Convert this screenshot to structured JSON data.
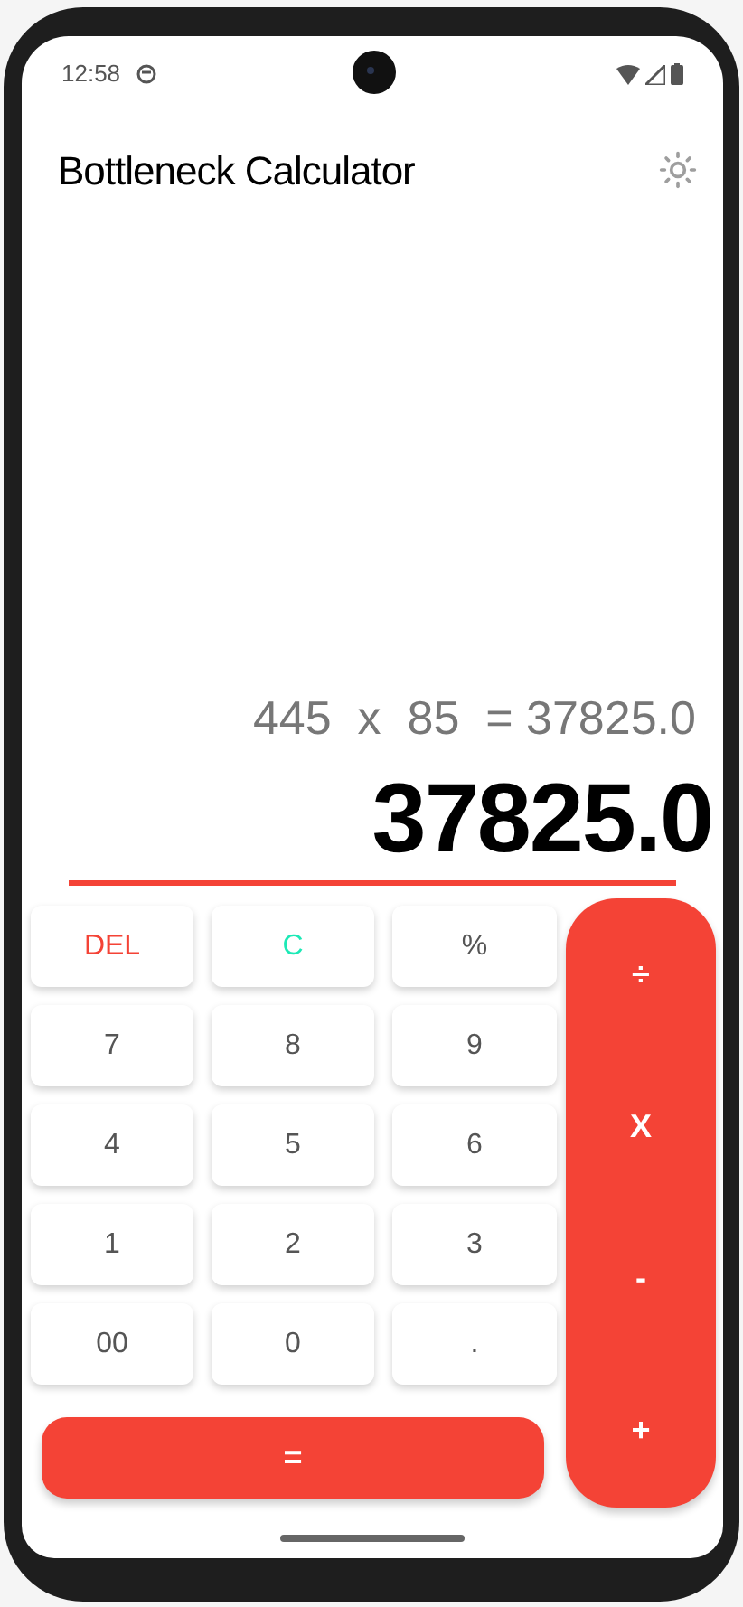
{
  "status_bar": {
    "time": "12:58"
  },
  "app_bar": {
    "title": "Bottleneck Calculator"
  },
  "display": {
    "expression": "445  x  85  = 37825.0",
    "result": "37825.0"
  },
  "keys": [
    {
      "label": "DEL",
      "kind": "delete"
    },
    {
      "label": "C",
      "kind": "clear"
    },
    {
      "label": "%",
      "kind": "digit"
    },
    {
      "label": "7",
      "kind": "digit"
    },
    {
      "label": "8",
      "kind": "digit"
    },
    {
      "label": "9",
      "kind": "digit"
    },
    {
      "label": "4",
      "kind": "digit"
    },
    {
      "label": "5",
      "kind": "digit"
    },
    {
      "label": "6",
      "kind": "digit"
    },
    {
      "label": "1",
      "kind": "digit"
    },
    {
      "label": "2",
      "kind": "digit"
    },
    {
      "label": "3",
      "kind": "digit"
    },
    {
      "label": "00",
      "kind": "digit"
    },
    {
      "label": "0",
      "kind": "digit"
    },
    {
      "label": ".",
      "kind": "digit"
    }
  ],
  "operators": [
    "÷",
    "X",
    "-",
    "+"
  ],
  "equals": "="
}
